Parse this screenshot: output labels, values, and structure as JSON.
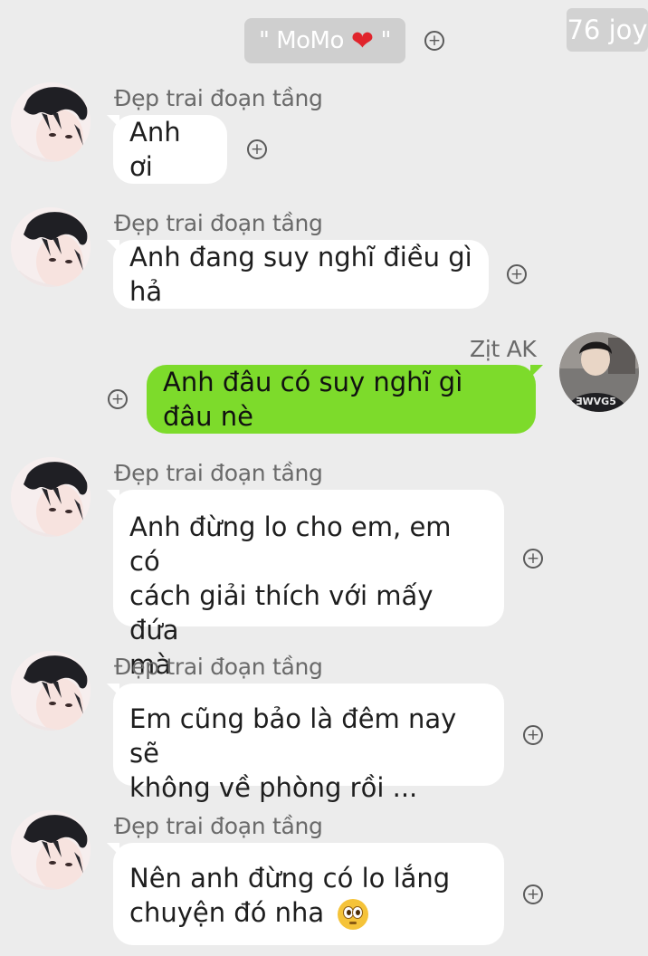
{
  "header": {
    "title_open": "\" MoMo",
    "heart": "❤",
    "title_close": "\""
  },
  "watermark": "76 joy",
  "messages": [
    {
      "sender": "Đẹp trai đoạn tầng",
      "lines": [
        "Anh ơi"
      ]
    },
    {
      "sender": "Đẹp trai đoạn tầng",
      "lines": [
        "Anh đang suy nghĩ điều gì hả"
      ]
    },
    {
      "sender": "Zịt AK",
      "lines": [
        "Anh đâu có suy nghĩ gì đâu nè"
      ],
      "outgoing": true
    },
    {
      "sender": "Đẹp trai đoạn tầng",
      "lines": [
        "Anh đừng lo cho em, em có",
        "cách giải thích với mấy đứa",
        "mà"
      ]
    },
    {
      "sender": "Đẹp trai đoạn tầng",
      "lines": [
        "Em cũng bảo là đêm nay sẽ",
        "không về phòng rồi ..."
      ]
    },
    {
      "sender": "Đẹp trai đoạn tầng",
      "lines": [
        "Nên anh đừng có lo lắng",
        "chuyện đó nha"
      ],
      "emoji": "pleading-face"
    }
  ],
  "colors": {
    "background": "#ececec",
    "outgoing_bubble": "#7ddb2b",
    "incoming_bubble": "#ffffff",
    "heart": "#e0242c"
  },
  "icons": [
    "add-reaction-icon",
    "heart-icon",
    "pleading-face-emoji"
  ]
}
